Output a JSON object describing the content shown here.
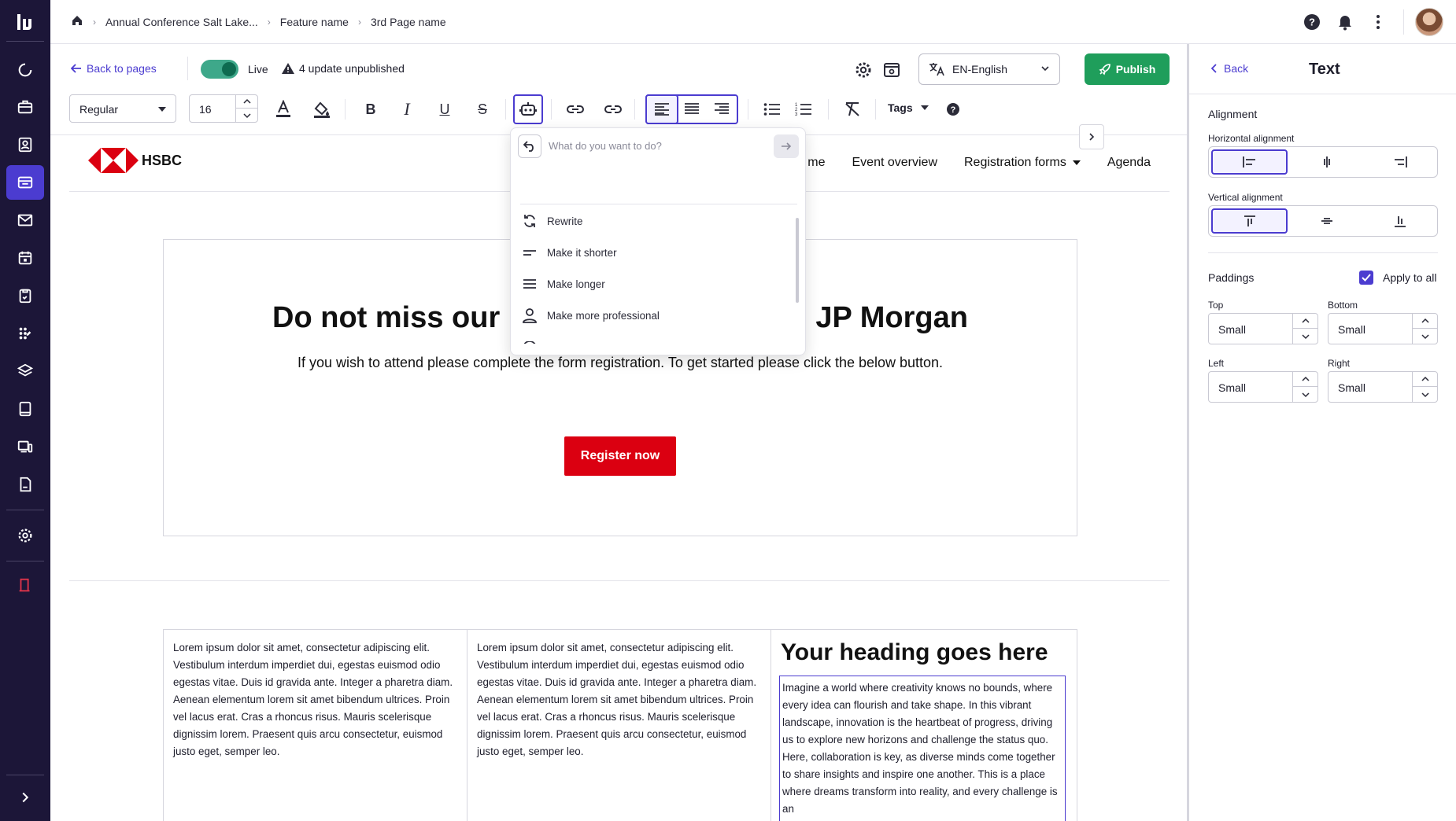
{
  "breadcrumb": [
    "Annual Conference Salt Lake...",
    "Feature name",
    "3rd Page name"
  ],
  "editor": {
    "back_label": "Back to pages",
    "live_label": "Live",
    "live_on": true,
    "unpublished_label": "4 update unpublished",
    "language": "EN-English",
    "publish_label": "Publish"
  },
  "toolbar": {
    "text_style": "Regular",
    "font_size": "16",
    "tags_label": "Tags"
  },
  "ai_menu": {
    "placeholder": "What do you want to do?",
    "options": [
      "Rewrite",
      "Make it shorter",
      "Make longer",
      "Make more professional"
    ]
  },
  "site": {
    "brand": "HSBC",
    "nav": [
      "me",
      "Event overview",
      "Registration forms",
      "Agenda"
    ],
    "hero_title": "Do not miss our Finance Summit with JP Morgan",
    "hero_text": "If you wish to attend please complete the form registration. To get started please click the below button.",
    "register_label": "Register now",
    "col1": "Lorem ipsum dolor sit amet, consectetur adipiscing elit. Vestibulum interdum imperdiet dui, egestas euismod odio egestas vitae. Duis id gravida ante. Integer a pharetra diam. Aenean elementum lorem sit amet bibendum ultrices. Proin vel lacus erat. Cras a rhoncus risus. Mauris scelerisque dignissim lorem. Praesent quis arcu consectetur, euismod justo eget, semper leo.",
    "col2": "Lorem ipsum dolor sit amet, consectetur adipiscing elit. Vestibulum interdum imperdiet dui, egestas euismod odio egestas vitae. Duis id gravida ante. Integer a pharetra diam. Aenean elementum lorem sit amet bibendum ultrices. Proin vel lacus erat. Cras a rhoncus risus. Mauris scelerisque dignissim lorem. Praesent quis arcu consectetur, euismod justo eget, semper leo.",
    "col3_heading": "Your heading goes here",
    "col3_text": "Imagine a world where creativity knows no bounds, where every idea can flourish and take shape. In this vibrant landscape, innovation is the heartbeat of progress, driving us to explore new horizons and challenge the status quo. Here, collaboration is key, as diverse minds come together to share insights and inspire one another. This is a place where dreams transform into reality, and every challenge is an"
  },
  "panel": {
    "back_label": "Back",
    "title": "Text",
    "alignment_label": "Alignment",
    "horizontal_label": "Horizontal alignment",
    "vertical_label": "Vertical alignment",
    "paddings_label": "Paddings",
    "apply_all_label": "Apply to all",
    "apply_all_checked": true,
    "top_label": "Top",
    "top_value": "Small",
    "bottom_label": "Bottom",
    "bottom_value": "Small",
    "left_label": "Left",
    "left_value": "Small",
    "right_label": "Right",
    "right_value": "Small"
  },
  "colors": {
    "nav_bg": "#1c1638",
    "accent": "#4b3cd0",
    "publish": "#1f9e5b",
    "brand_red": "#db0011"
  }
}
